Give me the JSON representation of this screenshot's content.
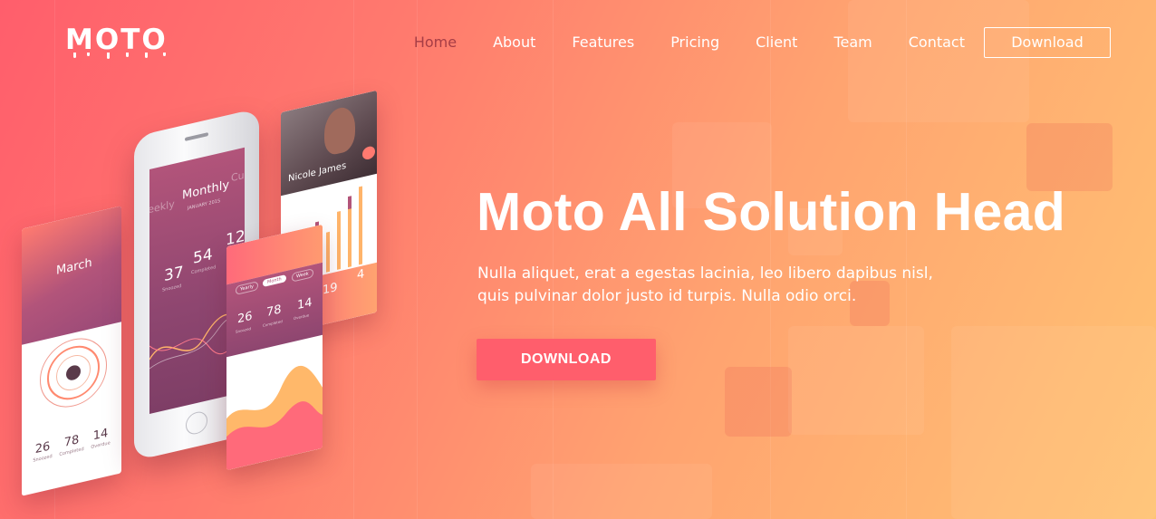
{
  "logo": {
    "text": "MOTO"
  },
  "nav": {
    "items": [
      {
        "label": "Home",
        "active": true
      },
      {
        "label": "About",
        "active": false
      },
      {
        "label": "Features",
        "active": false
      },
      {
        "label": "Pricing",
        "active": false
      },
      {
        "label": "Client",
        "active": false
      },
      {
        "label": "Team",
        "active": false
      },
      {
        "label": "Contact",
        "active": false
      }
    ],
    "download_label": "Download"
  },
  "hero": {
    "title": "Moto All Solution Head",
    "description_line1": "Nulla aliquet, erat a egestas lacinia, leo libero dapibus nisl,",
    "description_line2": "quis pulvinar dolor justo id turpis. Nulla odio orci.",
    "cta_label": "DOWNLOAD"
  },
  "mockup": {
    "left_screen": {
      "title": "March",
      "stats": [
        "26",
        "78",
        "14"
      ],
      "stat_labels": [
        "Snoozed",
        "Completed",
        "Overdue"
      ]
    },
    "phone_screen": {
      "tab_weekly": "Weekly",
      "title": "Monthly",
      "subtitle": "JANUARY 2015",
      "tab_custom": "Custo",
      "stats": [
        "37",
        "54",
        "12"
      ],
      "stat_labels": [
        "Snoozed",
        "Completed"
      ]
    },
    "middle_screen": {
      "tabs": [
        "Yearly",
        "Month",
        "Week"
      ],
      "stats": [
        "26",
        "78",
        "14"
      ],
      "stat_labels": [
        "Snoozed",
        "Completed",
        "Overdue"
      ]
    },
    "right_screen": {
      "name": "Nicole James",
      "stats": [
        "19",
        "4"
      ]
    }
  },
  "colors": {
    "accent": "#ff5e6c",
    "nav_active": "#a63d45",
    "gradient_start": "#ff5e6c",
    "gradient_end": "#ffc373"
  }
}
